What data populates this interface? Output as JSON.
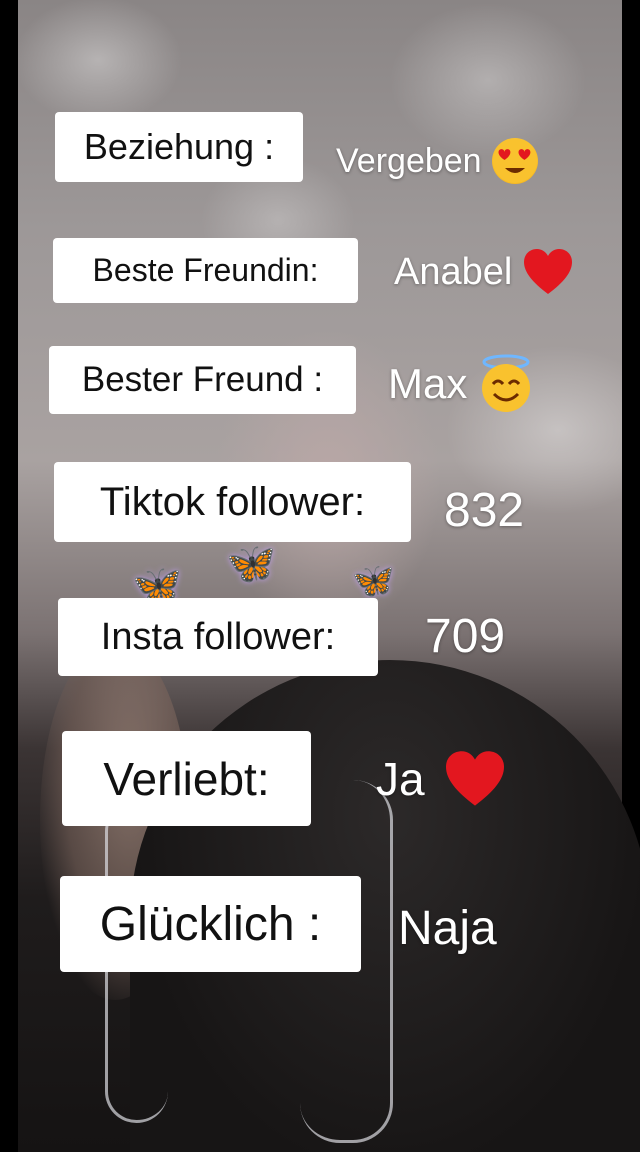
{
  "rows": [
    {
      "label": "Beziehung :",
      "value": "Vergeben",
      "icon": "heart-eyes-emoji-icon"
    },
    {
      "label": "Beste Freundin:",
      "value": "Anabel",
      "icon": "red-heart-icon"
    },
    {
      "label": "Bester Freund :",
      "value": "Max",
      "icon": "halo-smile-emoji-icon"
    },
    {
      "label": "Tiktok follower:",
      "value": "832"
    },
    {
      "label": "Insta follower:",
      "value": "709"
    },
    {
      "label": "Verliebt:",
      "value": "Ja",
      "icon": "red-heart-icon"
    },
    {
      "label": "Glücklich :",
      "value": "Naja"
    }
  ],
  "colors": {
    "label_bg": "#ffffff",
    "label_text": "#111111",
    "value_text": "#ffffff",
    "heart": "#e3171f",
    "butterfly": "#b58be8"
  }
}
